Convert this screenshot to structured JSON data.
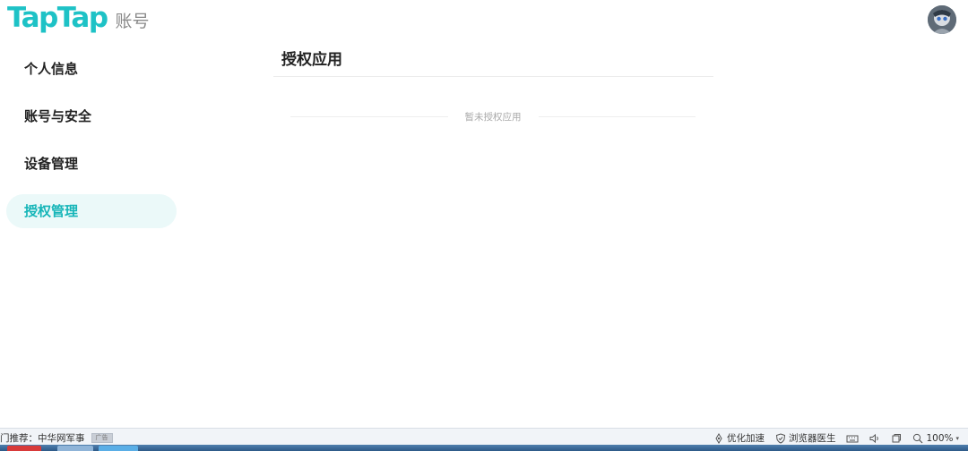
{
  "header": {
    "brand": "TapTap",
    "section": "账号"
  },
  "sidebar": {
    "items": [
      {
        "label": "个人信息",
        "active": false
      },
      {
        "label": "账号与安全",
        "active": false
      },
      {
        "label": "设备管理",
        "active": false
      },
      {
        "label": "授权管理",
        "active": true
      }
    ]
  },
  "main": {
    "title": "授权应用",
    "empty_text": "暂未授权应用"
  },
  "statusbar": {
    "left_text": "门推荐：中华网军事",
    "ad_label": "广告",
    "speedup": "优化加速",
    "doctor": "浏览器医生",
    "zoom": "100%"
  },
  "colors": {
    "brand": "#1ec2c6",
    "active_bg": "#ebf9f9",
    "active_text": "#15b5b8"
  },
  "icons": [
    "avatar",
    "rocket-icon",
    "shield-icon",
    "keyboard-icon",
    "volume-icon",
    "window-icon",
    "zoom-icon"
  ]
}
